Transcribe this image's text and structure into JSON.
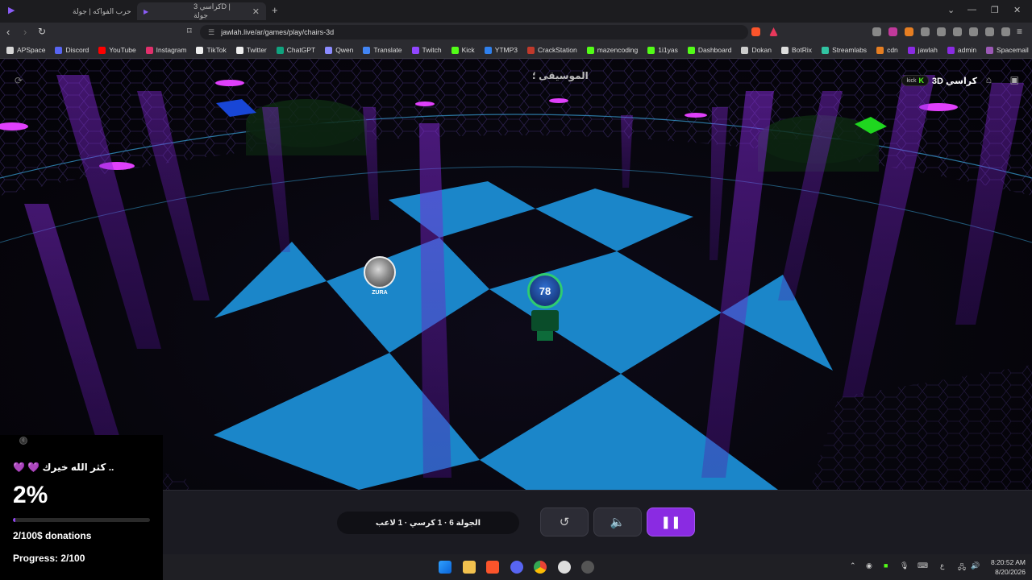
{
  "browser": {
    "tabs": [
      {
        "title": "حرب الفواكه | جولة",
        "active": false
      },
      {
        "title": "كراسي 3D | جولة",
        "active": true
      }
    ],
    "new_tab": "+",
    "url": "jawlah.live/ar/games/play/chairs-3d",
    "bookmarks": [
      {
        "label": "APSpace",
        "color": "#d6d6d6"
      },
      {
        "label": "Discord",
        "color": "#5865f2"
      },
      {
        "label": "YouTube",
        "color": "#ff0000"
      },
      {
        "label": "Instagram",
        "color": "#e1306c"
      },
      {
        "label": "TikTok",
        "color": "#eeeeee"
      },
      {
        "label": "Twitter",
        "color": "#eeeeee"
      },
      {
        "label": "ChatGPT",
        "color": "#10a37f"
      },
      {
        "label": "Qwen",
        "color": "#8b8bff"
      },
      {
        "label": "Translate",
        "color": "#4285f4"
      },
      {
        "label": "Twitch",
        "color": "#9146ff"
      },
      {
        "label": "Kick",
        "color": "#53fc18"
      },
      {
        "label": "YTMP3",
        "color": "#2f80ed"
      },
      {
        "label": "CrackStation",
        "color": "#c0392b"
      },
      {
        "label": "mazencoding",
        "color": "#53fc18"
      },
      {
        "label": "1i1yas",
        "color": "#53fc18"
      },
      {
        "label": "Dashboard",
        "color": "#53fc18"
      },
      {
        "label": "Dokan",
        "color": "#cccccc"
      },
      {
        "label": "BotRix",
        "color": "#dddddd"
      },
      {
        "label": "Streamlabs",
        "color": "#31c3a2"
      },
      {
        "label": "cdn",
        "color": "#e67e22"
      },
      {
        "label": "jawlah",
        "color": "#8a2be2"
      },
      {
        "label": "admin",
        "color": "#8a2be2"
      },
      {
        "label": "Spacemail",
        "color": "#9b59b6"
      }
    ],
    "more_bookmarks": "»"
  },
  "game": {
    "title": "كراسي 3D",
    "platform_badge": "kick",
    "music_label": "الموسيقى ؛",
    "players": [
      {
        "name": "ZURA"
      }
    ],
    "chair_number": "78",
    "round_info": "الجولة 6 · 1 كرسي · 1 لاعب"
  },
  "donation": {
    "message": ".. كثر الله خيرك 💜 💜",
    "percent": "2%",
    "progress_fraction": 0.02,
    "amount_text": "2/100$ donations",
    "progress_text": "Progress: 2/100"
  },
  "taskbar": {
    "tray_lang": "ع",
    "time": "8:20:52 AM",
    "date": "8/20/2026"
  },
  "colors": {
    "accent": "#8a2be2",
    "floor_tile": "#1b86c9",
    "neon_pillar": "#7a1fc9",
    "kick_green": "#53fc18"
  }
}
